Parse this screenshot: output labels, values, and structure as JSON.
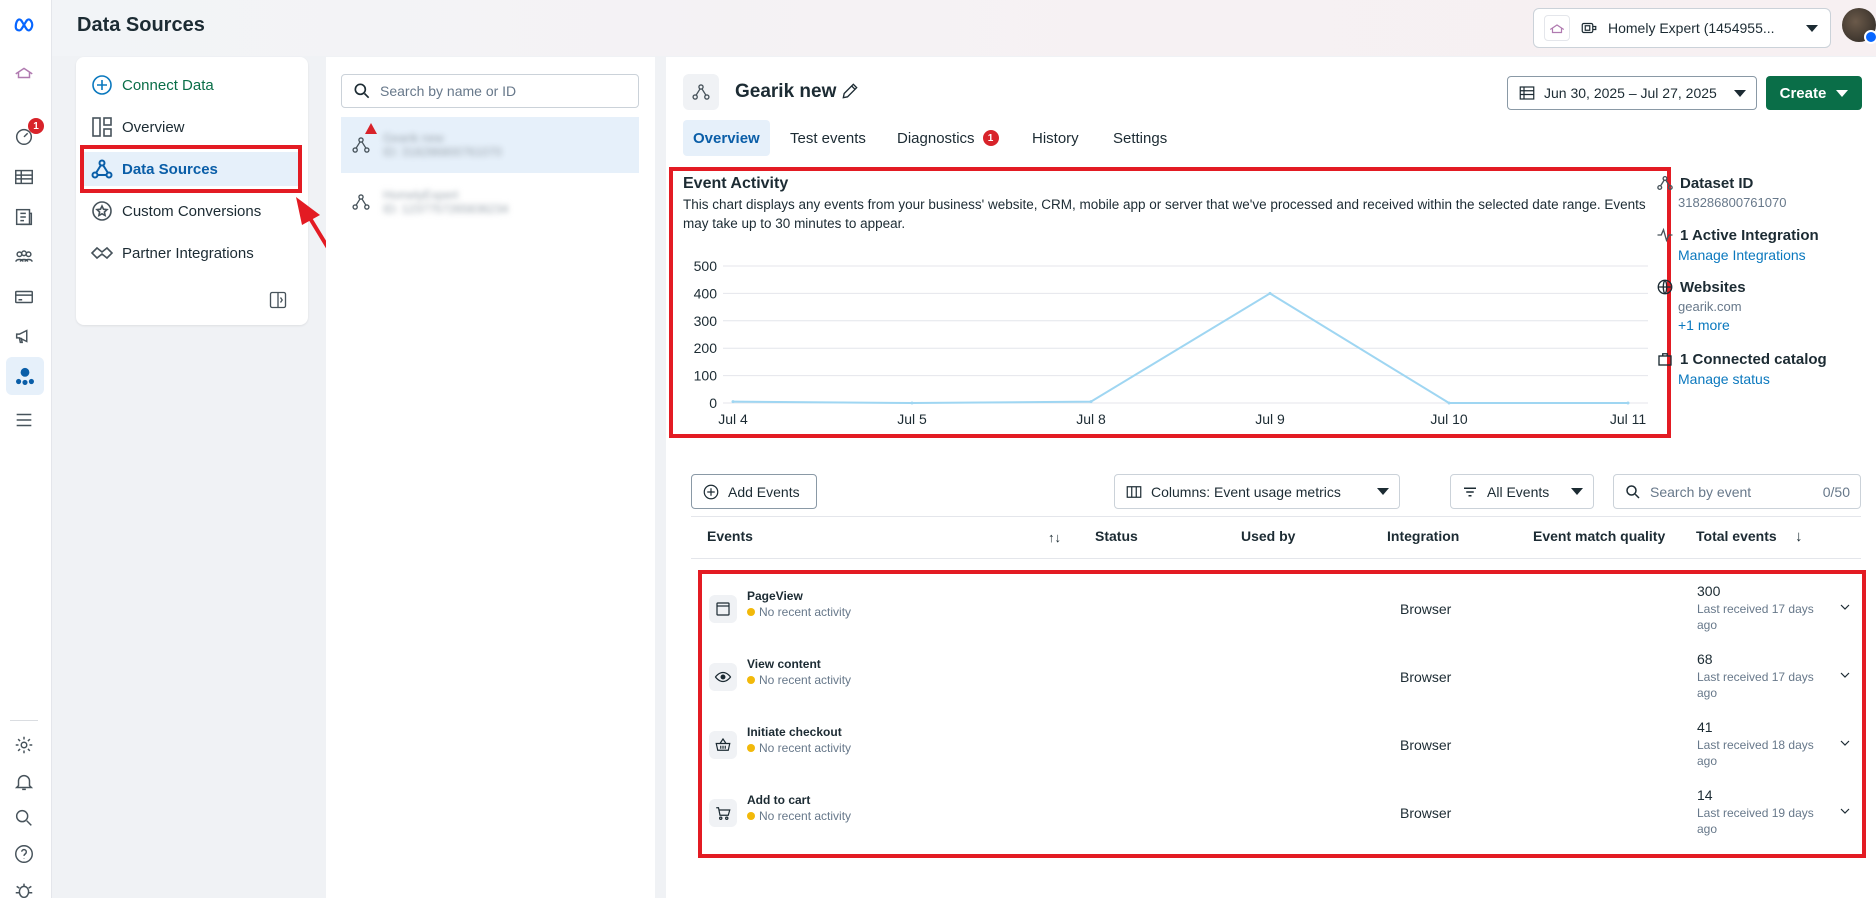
{
  "header": {
    "title": "Data Sources",
    "account_name": "Homely Expert (1454955..."
  },
  "rail": {
    "notification_count": "1"
  },
  "nav": {
    "items": [
      {
        "label": "Connect Data",
        "icon": "plus-circle-icon"
      },
      {
        "label": "Overview",
        "icon": "layout-icon"
      },
      {
        "label": "Data Sources",
        "icon": "network-icon"
      },
      {
        "label": "Custom Conversions",
        "icon": "star-badge-icon"
      },
      {
        "label": "Partner Integrations",
        "icon": "handshake-icon"
      }
    ]
  },
  "list": {
    "search_placeholder": "Search by name or ID",
    "items": [
      {
        "name": "Gearik new",
        "id": "ID: 318286800761070"
      },
      {
        "name": "HomelyExpert",
        "id": "ID: 1237757265836234"
      }
    ]
  },
  "dataset": {
    "name": "Gearik new",
    "date_range": "Jun 30, 2025 – Jul 27, 2025",
    "create_label": "Create",
    "tabs": [
      "Overview",
      "Test events",
      "Diagnostics",
      "History",
      "Settings"
    ],
    "diagnostics_count": "1"
  },
  "activity": {
    "title": "Event Activity",
    "description": "This chart displays any events from your business' website, CRM, mobile app or server that we've processed and received within the selected date range. Events may take up to 30 minutes to appear."
  },
  "chart_data": {
    "type": "line",
    "categories": [
      "Jul 4",
      "Jul 5",
      "Jul 8",
      "Jul 9",
      "Jul 10",
      "Jul 11"
    ],
    "series": [
      {
        "values": [
          5,
          0,
          5,
          400,
          0,
          0
        ]
      }
    ],
    "yticks": [
      "500",
      "400",
      "300",
      "200",
      "100",
      "0"
    ],
    "ylim": [
      0,
      500
    ],
    "grid": true,
    "color": "#9fd6f2"
  },
  "side": {
    "dataset_id_label": "Dataset ID",
    "dataset_id": "318286800761070",
    "integration_label": "1 Active Integration",
    "integration_link": "Manage Integrations",
    "websites_label": "Websites",
    "website": "gearik.com",
    "more_link": "+1 more",
    "catalog_label": "1 Connected catalog",
    "catalog_link": "Manage status"
  },
  "toolbar": {
    "add_events": "Add Events",
    "columns": "Columns: Event usage metrics",
    "filter": "All Events",
    "search_placeholder": "Search by event",
    "search_count": "0/50"
  },
  "table": {
    "headers": [
      "Events",
      "Status",
      "Used by",
      "Integration",
      "Event match quality",
      "Total events"
    ],
    "rows": [
      {
        "name": "PageView",
        "status": "No recent activity",
        "integration": "Browser",
        "total": "300",
        "received": "Last received 17 days ago",
        "icon": "browser-window-icon"
      },
      {
        "name": "View content",
        "status": "No recent activity",
        "integration": "Browser",
        "total": "68",
        "received": "Last received 17 days ago",
        "icon": "eye-icon"
      },
      {
        "name": "Initiate checkout",
        "status": "No recent activity",
        "integration": "Browser",
        "total": "41",
        "received": "Last received 18 days ago",
        "icon": "basket-icon"
      },
      {
        "name": "Add to cart",
        "status": "No recent activity",
        "integration": "Browser",
        "total": "14",
        "received": "Last received 19 days ago",
        "icon": "cart-icon"
      }
    ]
  },
  "colors": {
    "accent": "#0a78be",
    "create_button": "#0a6e48",
    "highlight": "#e31b23",
    "badge": "#d8232a"
  }
}
